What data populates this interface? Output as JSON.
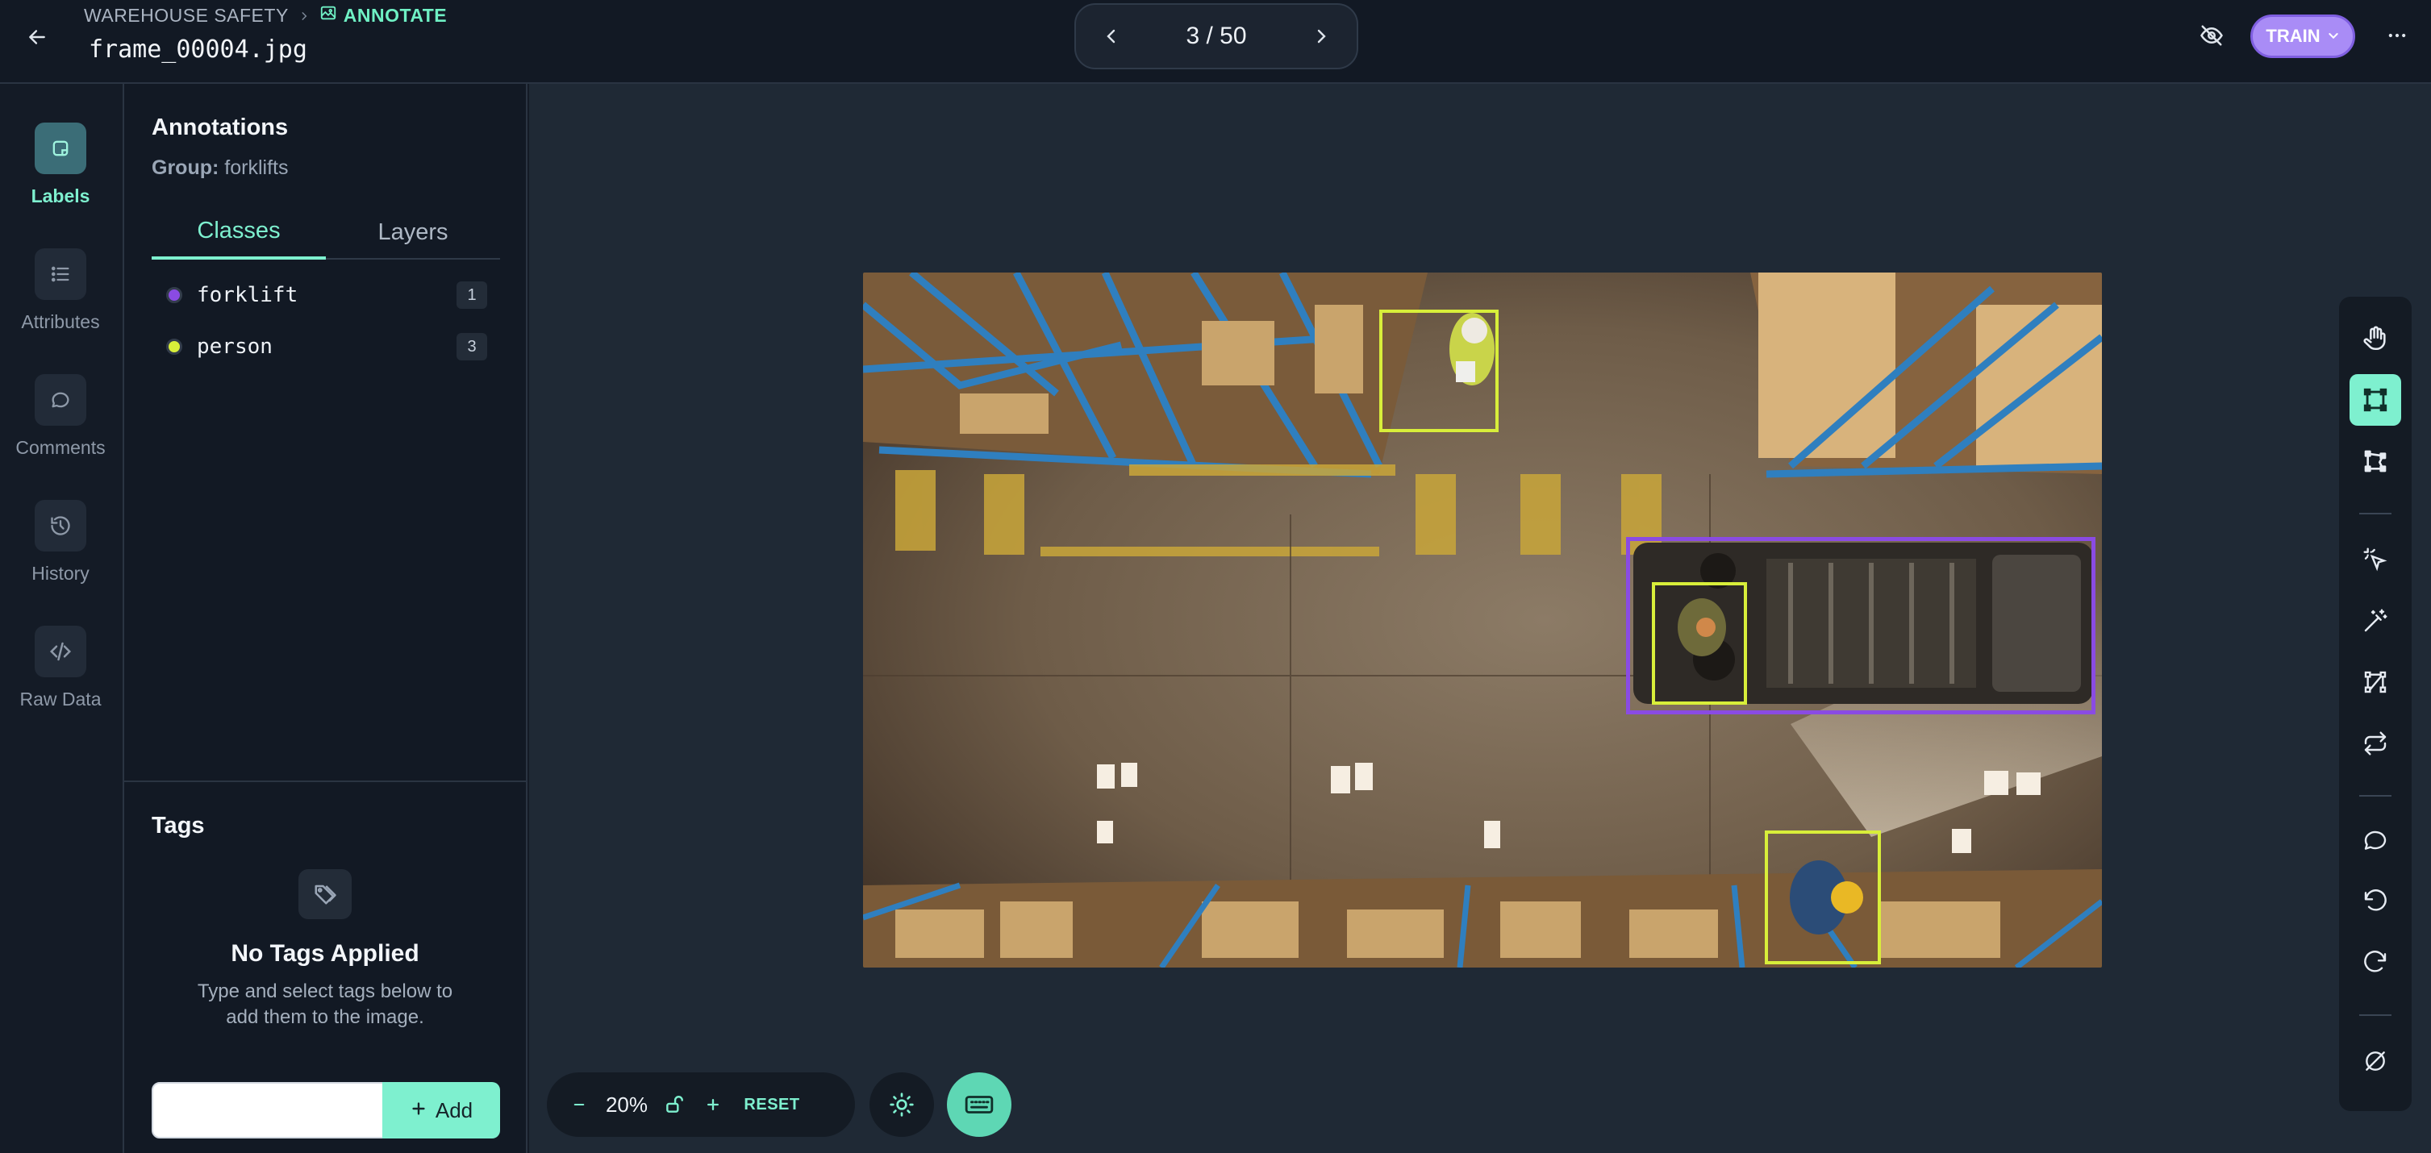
{
  "header": {
    "project": "WAREHOUSE SAFETY",
    "mode": "ANNOTATE",
    "filename": "frame_00004.jpg",
    "pager": "3 / 50",
    "train_label": "TRAIN"
  },
  "sidebar": {
    "items": [
      {
        "label": "Labels",
        "icon": "label-icon",
        "active": true
      },
      {
        "label": "Attributes",
        "icon": "list-icon",
        "active": false
      },
      {
        "label": "Comments",
        "icon": "comment-icon",
        "active": false
      },
      {
        "label": "History",
        "icon": "history-icon",
        "active": false
      },
      {
        "label": "Raw Data",
        "icon": "code-icon",
        "active": false
      }
    ]
  },
  "panel": {
    "title": "Annotations",
    "group_label": "Group:",
    "group_value": "forklifts",
    "tabs": [
      {
        "label": "Classes",
        "active": true
      },
      {
        "label": "Layers",
        "active": false
      }
    ],
    "classes": [
      {
        "name": "forklift",
        "count": "1",
        "color": "#8a4be3"
      },
      {
        "name": "person",
        "count": "3",
        "color": "#d8ee3a"
      }
    ]
  },
  "tags": {
    "title": "Tags",
    "empty_title": "No Tags Applied",
    "empty_sub": "Type and select tags below to add them to the image.",
    "input_value": "",
    "add_label": "Add"
  },
  "canvas": {
    "zoom": "20%",
    "reset_label": "RESET",
    "annotations": [
      {
        "class": "person"
      },
      {
        "class": "forklift"
      },
      {
        "class": "person"
      },
      {
        "class": "person"
      }
    ]
  },
  "colors": {
    "accent": "#7ef0cf",
    "forklift": "#8a4be3",
    "person": "#d8ee3a",
    "train": "#a98cf6"
  },
  "toolbar": {
    "tools": [
      "hand-icon",
      "bounding-box-icon",
      "polygon-icon",
      "magic-select-icon",
      "magic-wand-icon",
      "keypoints-icon",
      "repeat-icon",
      "comment-icon",
      "undo-icon",
      "redo-icon",
      "hide-annotations-icon"
    ],
    "active": "bounding-box-icon"
  }
}
